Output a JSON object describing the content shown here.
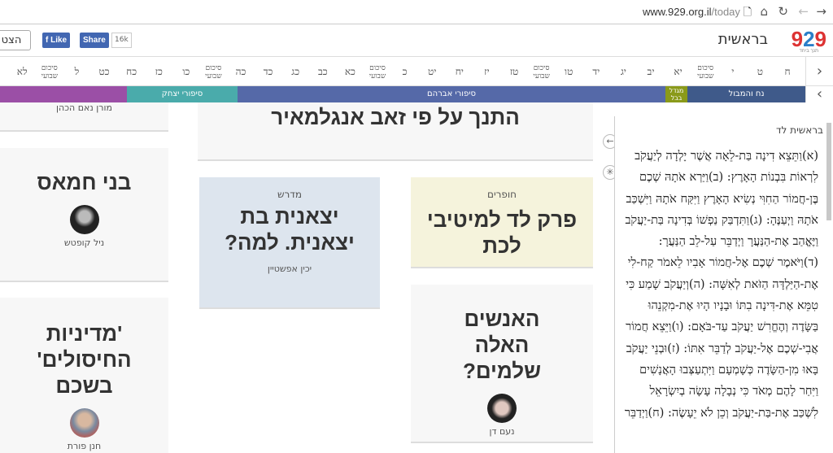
{
  "browser": {
    "url_host": "www.929.org.il",
    "url_path": "/today"
  },
  "header": {
    "logo": "929",
    "logo_sub": "תנך ביחד",
    "book": "בראשית",
    "save_label": "הצט",
    "like_label": "Like",
    "share_label": "Share",
    "share_count": "16k"
  },
  "chapters": [
    {
      "label": "ח"
    },
    {
      "label": "ט"
    },
    {
      "label": "י"
    },
    {
      "label": "סיכום שבועי",
      "summary": true
    },
    {
      "label": "יא"
    },
    {
      "label": "יב"
    },
    {
      "label": "יג"
    },
    {
      "label": "יד"
    },
    {
      "label": "טו"
    },
    {
      "label": "סיכום שבועי",
      "summary": true
    },
    {
      "label": "טז"
    },
    {
      "label": "יז"
    },
    {
      "label": "יח"
    },
    {
      "label": "יט"
    },
    {
      "label": "כ"
    },
    {
      "label": "סיכום שבועי",
      "summary": true
    },
    {
      "label": "כא"
    },
    {
      "label": "כב"
    },
    {
      "label": "כג"
    },
    {
      "label": "כד"
    },
    {
      "label": "כה"
    },
    {
      "label": "סיכום שבועי",
      "summary": true
    },
    {
      "label": "כו"
    },
    {
      "label": "כז"
    },
    {
      "label": "כח"
    },
    {
      "label": "כט"
    },
    {
      "label": "ל"
    },
    {
      "label": "סיכום שבועי",
      "summary": true
    },
    {
      "label": "לא"
    }
  ],
  "story_segments": [
    {
      "label": "נח והמבול",
      "color": "#3f5a8a"
    },
    {
      "label": "מגדל בבל",
      "color": "#8a9a1a"
    },
    {
      "label": "סיפורי אברהם",
      "color": "#5569a8"
    },
    {
      "label": "סיפורי יצחק",
      "color": "#4aabab"
    },
    {
      "label": "",
      "color": "#9b4fa6"
    }
  ],
  "cards": {
    "top_author": "מורן נאם הכהן",
    "bnei_hamas": {
      "title": "בני חמאס",
      "author": "ניל קופטש"
    },
    "policy": {
      "title": "'מדיניות החיסולים' בשכם",
      "author": "חנן פורת"
    },
    "tanakh": {
      "title": "התנך על פי זאב אנגלמאיר"
    },
    "midrash": {
      "category": "מדרש",
      "title": "יצאנית בת יצאנית. למה?",
      "author": "יכין אפשטיין"
    },
    "hofrim": {
      "category": "חופרים",
      "title": "פרק לד למיטיבי לכת"
    },
    "people": {
      "title": "האנשים האלה שלמים?",
      "author": "נעם דן"
    }
  },
  "panel": {
    "title": "בראשית לד",
    "text": "(א)וַתֵּצֵא דִינָה בַּת-לֵאָה אֲשֶׁר יָלְדָה לְיַעֲקֹב לִרְאוֹת בִּבְנוֹת הָאָרֶץ: (ב)וַיַּרְא אֹתָהּ שְׁכֶם בֶּן-חֲמוֹר הַחִוִּי נְשִׂיא הָאָרֶץ וַיִּקַּח אֹתָהּ וַיִּשְׁכַּב אֹתָהּ וַיְעַנֶּהָ: (ג)וַתִּדְבַּק נַפְשׁוֹ בְּדִינָה בַּת-יַעֲקֹב וַיֶּאֱהַב אֶת-הַנַּעֲרָ וַיְדַבֵּר עַל-לֵב הַנַּעֲרָ: (ד)וַיֹּאמֶר שְׁכֶם אֶל-חֲמוֹר אָבִיו לֵאמֹר קַח-לִי אֶת-הַיַּלְדָּה הַזֹּאת לְאִשָּׁה: (ה)וְיַעֲקֹב שָׁמַע כִּי טִמֵּא אֶת-דִּינָה בִתּוֹ וּבָנָיו הָיוּ אֶת-מִקְנֵהוּ בַּשָּׂדֶה וְהֶחֱרִשׁ יַעֲקֹב עַד-בֹּאָם: (ו)וַיֵּצֵא חֲמוֹר אֲבִי-שְׁכֶם אֶל-יַעֲקֹב לְדַבֵּר אִתּוֹ: (ז)וּבְנֵי יַעֲקֹב בָּאוּ מִן-הַשָּׂדֶה כְּשָׁמְעָם וַיִּתְעַצְּבוּ הָאֲנָשִׁים וַיִּחַר לָהֶם מְאֹד כִּי נְבָלָה עָשָׂה בְיִשְׂרָאֵל לִשְׁכַּב אֶת-בַּת-יַעֲקֹב וְכֵן לֹא יֵעָשֶׂה: (ח)וַיְדַבֵּר"
  }
}
